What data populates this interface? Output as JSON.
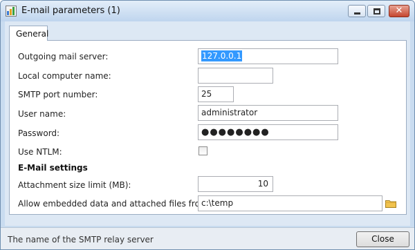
{
  "window": {
    "title": "E-mail parameters (1)",
    "controls": {
      "close_glyph": "✕"
    }
  },
  "tabs": [
    {
      "label": "General"
    }
  ],
  "form": {
    "outgoing_mail_server": {
      "label": "Outgoing mail server:",
      "value": "127.0.0.1"
    },
    "local_computer_name": {
      "label": "Local computer name:",
      "value": ""
    },
    "smtp_port_number": {
      "label": "SMTP port number:",
      "value": "25"
    },
    "user_name": {
      "label": "User name:",
      "value": "administrator"
    },
    "password": {
      "label": "Password:",
      "value": "●●●●●●●●"
    },
    "use_ntlm": {
      "label": "Use NTLM:",
      "checked": false
    }
  },
  "email_settings": {
    "heading": "E-Mail settings",
    "attachment_size_limit": {
      "label": "Attachment size limit (MB):",
      "value": "10"
    },
    "embedded_data_path": {
      "label": "Allow embedded data and attached files from:",
      "value": "c:\\temp"
    }
  },
  "status": {
    "text": "The name of the SMTP relay server"
  },
  "buttons": {
    "close_label": "Close"
  },
  "icons": {
    "app": "app-icon",
    "folder": "folder-icon"
  },
  "colors": {
    "selection": "#3399ff",
    "close_red": "#c5462f"
  }
}
